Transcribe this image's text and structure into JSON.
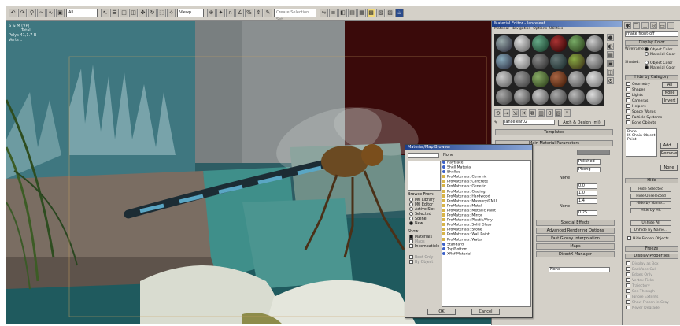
{
  "toolbar": {
    "view_dropdown": "All",
    "coord_dropdown": "Viewp",
    "selection_set": "Create Selection Set"
  },
  "viewport": {
    "label": "S & M (VP)",
    "stats": [
      "Total",
      "Polys  41,1.7 B",
      "Verts  .."
    ]
  },
  "material_editor": {
    "title": "Material Editor - lanceleaf",
    "menu": [
      "Material",
      "Navigation",
      "Options",
      "Utilities"
    ],
    "material_name": "lanceleaf02",
    "material_type": "Arch & Design (mi)",
    "rollouts": {
      "templates": "Templates",
      "main_params": "Main Material Parameters",
      "special_effects": "Special Effects",
      "adv_render": "Advanced Rendering Options",
      "fast_glossy": "Fast Glossy Interpolation",
      "maps": "Maps",
      "direct_x": "DirectX Manager",
      "mr_connection": "mental ray Connection"
    },
    "fields": {
      "shading": "Phong",
      "finish": "Polished",
      "reflection": "0.0",
      "glossiness": "1.0",
      "ior": "1.4",
      "none1": "None",
      "none2": "None",
      "none3": "None",
      "value1": "0.25",
      "value2": "0.0"
    }
  },
  "browser": {
    "title": "Material/Map Browser",
    "search_value": "",
    "header": "None",
    "browse_from_label": "Browse From:",
    "browse_from": [
      "Mtl Library",
      "Mtl Editor",
      "Active Slot",
      "Selected",
      "Scene",
      "New"
    ],
    "show_label": "Show",
    "show": [
      "Materials",
      "Maps",
      "Incompatible"
    ],
    "root_label": "Root Only",
    "by_object_label": "By Object",
    "items": [
      {
        "name": "Raytrace",
        "icon": "blue"
      },
      {
        "name": "Shell Material",
        "icon": "blue"
      },
      {
        "name": "Shellac",
        "icon": "blue"
      },
      {
        "name": "ProMaterials: Ceramic",
        "icon": "fold"
      },
      {
        "name": "ProMaterials: Concrete",
        "icon": "fold"
      },
      {
        "name": "ProMaterials: Generic",
        "icon": "fold"
      },
      {
        "name": "ProMaterials: Glazing",
        "icon": "fold"
      },
      {
        "name": "ProMaterials: Hardwood",
        "icon": "fold"
      },
      {
        "name": "ProMaterials: Masonry/CMU",
        "icon": "fold"
      },
      {
        "name": "ProMaterials: Metal",
        "icon": "fold"
      },
      {
        "name": "ProMaterials: Metallic Paint",
        "icon": "fold"
      },
      {
        "name": "ProMaterials: Mirror",
        "icon": "fold"
      },
      {
        "name": "ProMaterials: Plastic/Vinyl",
        "icon": "fold"
      },
      {
        "name": "ProMaterials: Solid Glass",
        "icon": "fold"
      },
      {
        "name": "ProMaterials: Stone",
        "icon": "fold"
      },
      {
        "name": "ProMaterials: Wall Paint",
        "icon": "fold"
      },
      {
        "name": "ProMaterials: Water",
        "icon": "fold"
      },
      {
        "name": "Standard",
        "icon": "blue"
      },
      {
        "name": "Top/Bottom",
        "icon": "blue"
      },
      {
        "name": "XRef Material",
        "icon": "blue"
      }
    ],
    "ok_label": "OK",
    "cancel_label": "Cancel"
  },
  "command_panel": {
    "name_field": "make front-off",
    "display_color_header": "Display Color",
    "wireframe_label": "Wireframe:",
    "wire_object_color": "Object Color",
    "wire_material_color": "Material Color",
    "shaded_label": "Shaded:",
    "shaded_object_color": "Object Color",
    "shaded_material_color": "Material Color",
    "hide_by_category": "Hide by Category",
    "categories": [
      "Geometry",
      "Shapes",
      "Lights",
      "Cameras",
      "Helpers",
      "Space Warps",
      "Particle Systems",
      "Bone Objects"
    ],
    "all_btn": "All",
    "none_btn": "None",
    "invert_btn": "Invert",
    "list_items": [
      "Bone",
      "IK Chain Object",
      "Point"
    ],
    "add_btn": "Add...",
    "remove_btn": "Remove",
    "none2_btn": "None",
    "hide_header": "Hide",
    "hide_buttons": [
      "Hide Selected",
      "Hide Unselected",
      "Hide by Name...",
      "Hide by Hit"
    ],
    "unhide_buttons": [
      "Unhide All",
      "Unhide by Name..."
    ],
    "hide_frozen": "Hide Frozen Objects",
    "freeze_header": "Freeze",
    "display_props_header": "Display Properties",
    "display_props": [
      "Display as Box",
      "Backface Cull",
      "Edges Only",
      "Vertex Ticks",
      "Trajectory",
      "See-Through",
      "Ignore Extents",
      "Show Frozen in Gray",
      "Never Degrade"
    ]
  }
}
